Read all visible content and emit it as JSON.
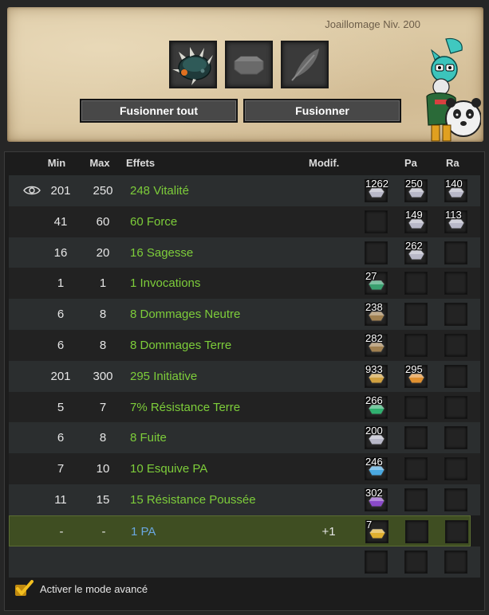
{
  "header": {
    "job_title": "Joaillomage Niv. 200",
    "slots": [
      {
        "icon": "spiked-helmet-item-icon"
      },
      {
        "icon": "octagon-rune-placeholder-icon"
      },
      {
        "icon": "feather-placeholder-icon"
      }
    ],
    "buttons": {
      "fuse_all": "Fusionner tout",
      "fuse": "Fusionner"
    },
    "avatar_icon": "character-avatar"
  },
  "table": {
    "columns": {
      "min": "Min",
      "max": "Max",
      "effects": "Effets",
      "modif": "Modif.",
      "pa": "Pa",
      "ra": "Ra"
    },
    "rows": [
      {
        "min": "201",
        "max": "250",
        "effect": "248 Vitalité",
        "modif": "",
        "eye": true,
        "runes": [
          {
            "count": "1262",
            "color": "#b8b8c8"
          },
          {
            "count": "250",
            "color": "#b8b8c8"
          },
          {
            "count": "140",
            "color": "#b8b8c8"
          }
        ]
      },
      {
        "min": "41",
        "max": "60",
        "effect": "60 Force",
        "modif": "",
        "runes": [
          {
            "count": "",
            "color": ""
          },
          {
            "count": "149",
            "color": "#b8b8c8"
          },
          {
            "count": "113",
            "color": "#b8b8c8"
          }
        ]
      },
      {
        "min": "16",
        "max": "20",
        "effect": "16 Sagesse",
        "modif": "",
        "runes": [
          {
            "count": "",
            "color": ""
          },
          {
            "count": "262",
            "color": "#b8b8c8"
          },
          {
            "count": "",
            "color": ""
          }
        ]
      },
      {
        "min": "1",
        "max": "1",
        "effect": "1 Invocations",
        "modif": "",
        "runes": [
          {
            "count": "27",
            "color": "#3aa070"
          },
          {
            "count": "",
            "color": ""
          },
          {
            "count": "",
            "color": ""
          }
        ]
      },
      {
        "min": "6",
        "max": "8",
        "effect": "8 Dommages Neutre",
        "modif": "",
        "runes": [
          {
            "count": "238",
            "color": "#a08050"
          },
          {
            "count": "",
            "color": ""
          },
          {
            "count": "",
            "color": ""
          }
        ]
      },
      {
        "min": "6",
        "max": "8",
        "effect": "8 Dommages Terre",
        "modif": "",
        "runes": [
          {
            "count": "282",
            "color": "#a08050"
          },
          {
            "count": "",
            "color": ""
          },
          {
            "count": "",
            "color": ""
          }
        ]
      },
      {
        "min": "201",
        "max": "300",
        "effect": "295 Initiative",
        "modif": "",
        "runes": [
          {
            "count": "933",
            "color": "#d0a040"
          },
          {
            "count": "295",
            "color": "#e09030"
          },
          {
            "count": "",
            "color": ""
          }
        ]
      },
      {
        "min": "5",
        "max": "7",
        "effect": "7% Résistance Terre",
        "modif": "",
        "runes": [
          {
            "count": "266",
            "color": "#30b070"
          },
          {
            "count": "",
            "color": ""
          },
          {
            "count": "",
            "color": ""
          }
        ]
      },
      {
        "min": "6",
        "max": "8",
        "effect": "8 Fuite",
        "modif": "",
        "runes": [
          {
            "count": "200",
            "color": "#b8b8c8"
          },
          {
            "count": "",
            "color": ""
          },
          {
            "count": "",
            "color": ""
          }
        ]
      },
      {
        "min": "7",
        "max": "10",
        "effect": "10 Esquive PA",
        "modif": "",
        "runes": [
          {
            "count": "246",
            "color": "#4aa8e0"
          },
          {
            "count": "",
            "color": ""
          },
          {
            "count": "",
            "color": ""
          }
        ]
      },
      {
        "min": "11",
        "max": "15",
        "effect": "15 Résistance Poussée",
        "modif": "",
        "runes": [
          {
            "count": "302",
            "color": "#8a4ac8"
          },
          {
            "count": "",
            "color": ""
          },
          {
            "count": "",
            "color": ""
          }
        ]
      },
      {
        "min": "-",
        "max": "-",
        "effect": "1 PA",
        "modif": "+1",
        "selected": true,
        "runes": [
          {
            "count": "7",
            "color": "#e0b030"
          },
          {
            "count": "",
            "color": ""
          },
          {
            "count": "",
            "color": ""
          }
        ]
      },
      {
        "min": "",
        "max": "",
        "effect": "",
        "modif": "",
        "runes": [
          {
            "count": "",
            "color": ""
          },
          {
            "count": "",
            "color": ""
          },
          {
            "count": "",
            "color": ""
          }
        ]
      }
    ]
  },
  "footer": {
    "advanced_mode_label": "Activer le mode avancé",
    "advanced_mode_checked": true
  },
  "colors": {
    "effect_green": "#7dcd3a",
    "effect_blue": "#6aa7e0",
    "selected_row": "#3f4e22"
  }
}
